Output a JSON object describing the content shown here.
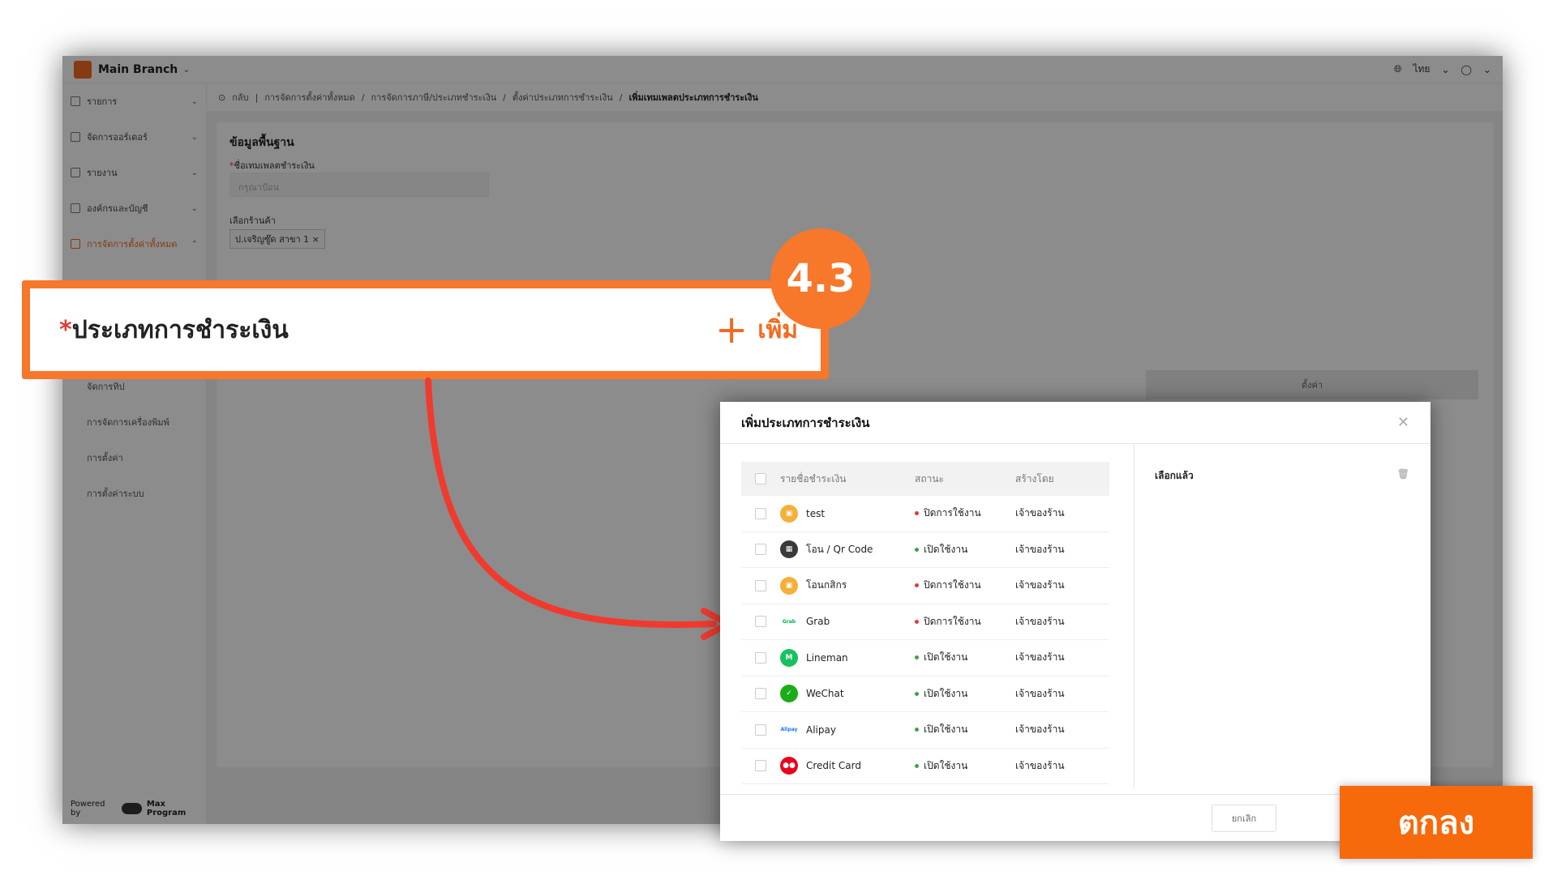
{
  "app": {
    "branch": "Main Branch",
    "language": "ไทย"
  },
  "sidebar": {
    "items": [
      {
        "label": "รายการ",
        "icon": "list-icon"
      },
      {
        "label": "จัดการออร์เดอร์",
        "icon": "order-icon"
      },
      {
        "label": "รายงาน",
        "icon": "clock-icon"
      },
      {
        "label": "องค์กรและบัญชี",
        "icon": "people-icon"
      },
      {
        "label": "การจัดการตั้งค่าทั้งหมด",
        "icon": "settings-icon",
        "active": true
      }
    ],
    "subitems": [
      "จัดการทิป",
      "การจัดการเครื่องพิมพ์",
      "การตั้งค่า",
      "การตั้งค่าระบบ"
    ],
    "powered_by": "Powered by",
    "powered_brand": "Max Program"
  },
  "breadcrumb": {
    "back": "กลับ",
    "items": [
      "การจัดการตั้งค่าทั้งหมด",
      "การจัดการภาษี/ประเภทชำระเงิน",
      "ตั้งค่าประเภทการชำระเงิน",
      "เพิ่มเทมเพลตประเภทการชำระเงิน"
    ]
  },
  "form": {
    "section_title": "ข้อมูลพื้นฐาน",
    "template_name_label": "ชื่อเทมเพลตชำระเงิน",
    "template_name_placeholder": "กรุณาป้อน",
    "store_label": "เลือกร้านค้า",
    "store_tag": "ป.เจริญซู๊ด สาขา 1",
    "settings_label": "ตั้งค่า"
  },
  "callout": {
    "step": "4.3",
    "required_mark": "*",
    "title": "ประเภทการชำระเงิน",
    "add_label": "เพิ่ม"
  },
  "modal": {
    "title": "เพิ่มประเภทการชำระเงิน",
    "columns": [
      "รายชื่อชำระเงิน",
      "สถานะ",
      "สร้างโดย"
    ],
    "selected_title": "เลือกแล้ว",
    "rows": [
      {
        "name": "test",
        "status": "ปิดการใช้งาน",
        "status_color": "#e53935",
        "by": "เจ้าของร้าน",
        "icon": "wallet-icon",
        "icon_color": "#f5b03a"
      },
      {
        "name": "โอน / Qr Code",
        "status": "เปิดใช้งาน",
        "status_color": "#43a047",
        "by": "เจ้าของร้าน",
        "icon": "qr-icon",
        "icon_color": "#3a3a3a"
      },
      {
        "name": "โอนกสิกร",
        "status": "ปิดการใช้งาน",
        "status_color": "#e53935",
        "by": "เจ้าของร้าน",
        "icon": "wallet-icon",
        "icon_color": "#f5b03a"
      },
      {
        "name": "Grab",
        "status": "ปิดการใช้งาน",
        "status_color": "#e53935",
        "by": "เจ้าของร้าน",
        "icon": "grab-icon",
        "icon_color": "#00b14f"
      },
      {
        "name": "Lineman",
        "status": "เปิดใช้งาน",
        "status_color": "#43a047",
        "by": "เจ้าของร้าน",
        "icon": "lineman-icon",
        "icon_color": "#17c15f"
      },
      {
        "name": "WeChat",
        "status": "เปิดใช้งาน",
        "status_color": "#43a047",
        "by": "เจ้าของร้าน",
        "icon": "wechat-icon",
        "icon_color": "#1aad19"
      },
      {
        "name": "Alipay",
        "status": "เปิดใช้งาน",
        "status_color": "#43a047",
        "by": "เจ้าของร้าน",
        "icon": "alipay-icon",
        "icon_color": "#1677ff"
      },
      {
        "name": "Credit Card",
        "status": "เปิดใช้งาน",
        "status_color": "#43a047",
        "by": "เจ้าของร้าน",
        "icon": "credit-card-icon",
        "icon_color": "#eb001b"
      }
    ],
    "cancel_label": "ยกเลิก",
    "ok_label": "ตกลง"
  },
  "colors": {
    "accent": "#f7772b",
    "ok_button": "#f76a0c"
  }
}
